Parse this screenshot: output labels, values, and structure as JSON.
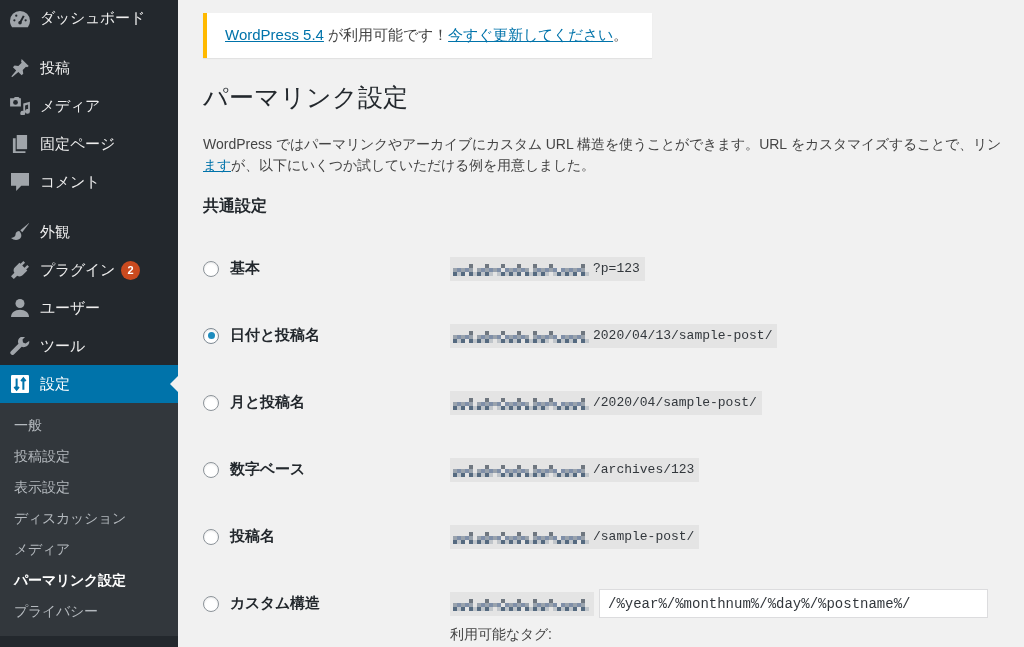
{
  "sidebar": {
    "groups": [
      [
        {
          "label": "ダッシュボード",
          "selected": false
        }
      ],
      [
        {
          "label": "投稿",
          "selected": false
        },
        {
          "label": "メディア",
          "selected": false
        },
        {
          "label": "固定ページ",
          "selected": false
        },
        {
          "label": "コメント",
          "selected": false
        }
      ],
      [
        {
          "label": "外観",
          "selected": false
        },
        {
          "label": "プラグイン",
          "selected": false,
          "badge": "2"
        },
        {
          "label": "ユーザー",
          "selected": false
        },
        {
          "label": "ツール",
          "selected": false
        },
        {
          "label": "設定",
          "selected": true,
          "children": [
            {
              "label": "一般",
              "selected": false
            },
            {
              "label": "投稿設定",
              "selected": false
            },
            {
              "label": "表示設定",
              "selected": false
            },
            {
              "label": "ディスカッション",
              "selected": false
            },
            {
              "label": "メディア",
              "selected": false
            },
            {
              "label": "パーマリンク設定",
              "selected": true
            },
            {
              "label": "プライバシー",
              "selected": false
            }
          ]
        }
      ]
    ]
  },
  "notice": {
    "parts": [
      {
        "kind": "link",
        "text": "WordPress 5.4"
      },
      {
        "kind": "text",
        "text": " が利用可能です！"
      },
      {
        "kind": "link",
        "text": "今すぐ更新してください"
      },
      {
        "kind": "text",
        "text": "。"
      }
    ]
  },
  "page_title": "パーマリンク設定",
  "description": {
    "lines": [
      [
        {
          "kind": "text",
          "text": "WordPress ではパーマリンクやアーカイブにカスタム URL 構造を使うことができます。URL をカスタマイズすることで、リン"
        }
      ],
      [
        {
          "kind": "link",
          "text": "ます"
        },
        {
          "kind": "text",
          "text": "が、以下にいくつか試していただける例を用意しました。"
        }
      ]
    ]
  },
  "section_title": "共通設定",
  "permalink_options": [
    {
      "kind": "preset",
      "label": "基本",
      "selected": false,
      "url_path": "?p=123"
    },
    {
      "kind": "preset",
      "label": "日付と投稿名",
      "selected": true,
      "url_path": "2020/04/13/sample-post/"
    },
    {
      "kind": "preset",
      "label": "月と投稿名",
      "selected": false,
      "url_path": "/2020/04/sample-post/"
    },
    {
      "kind": "preset",
      "label": "数字ベース",
      "selected": false,
      "url_path": "/archives/123"
    },
    {
      "kind": "preset",
      "label": "投稿名",
      "selected": false,
      "url_path": "/sample-post/"
    },
    {
      "kind": "custom",
      "label": "カスタム構造",
      "selected": false,
      "value": "/%year%/%monthnum%/%day%/%postname%/",
      "note": "利用可能なタグ:"
    }
  ]
}
